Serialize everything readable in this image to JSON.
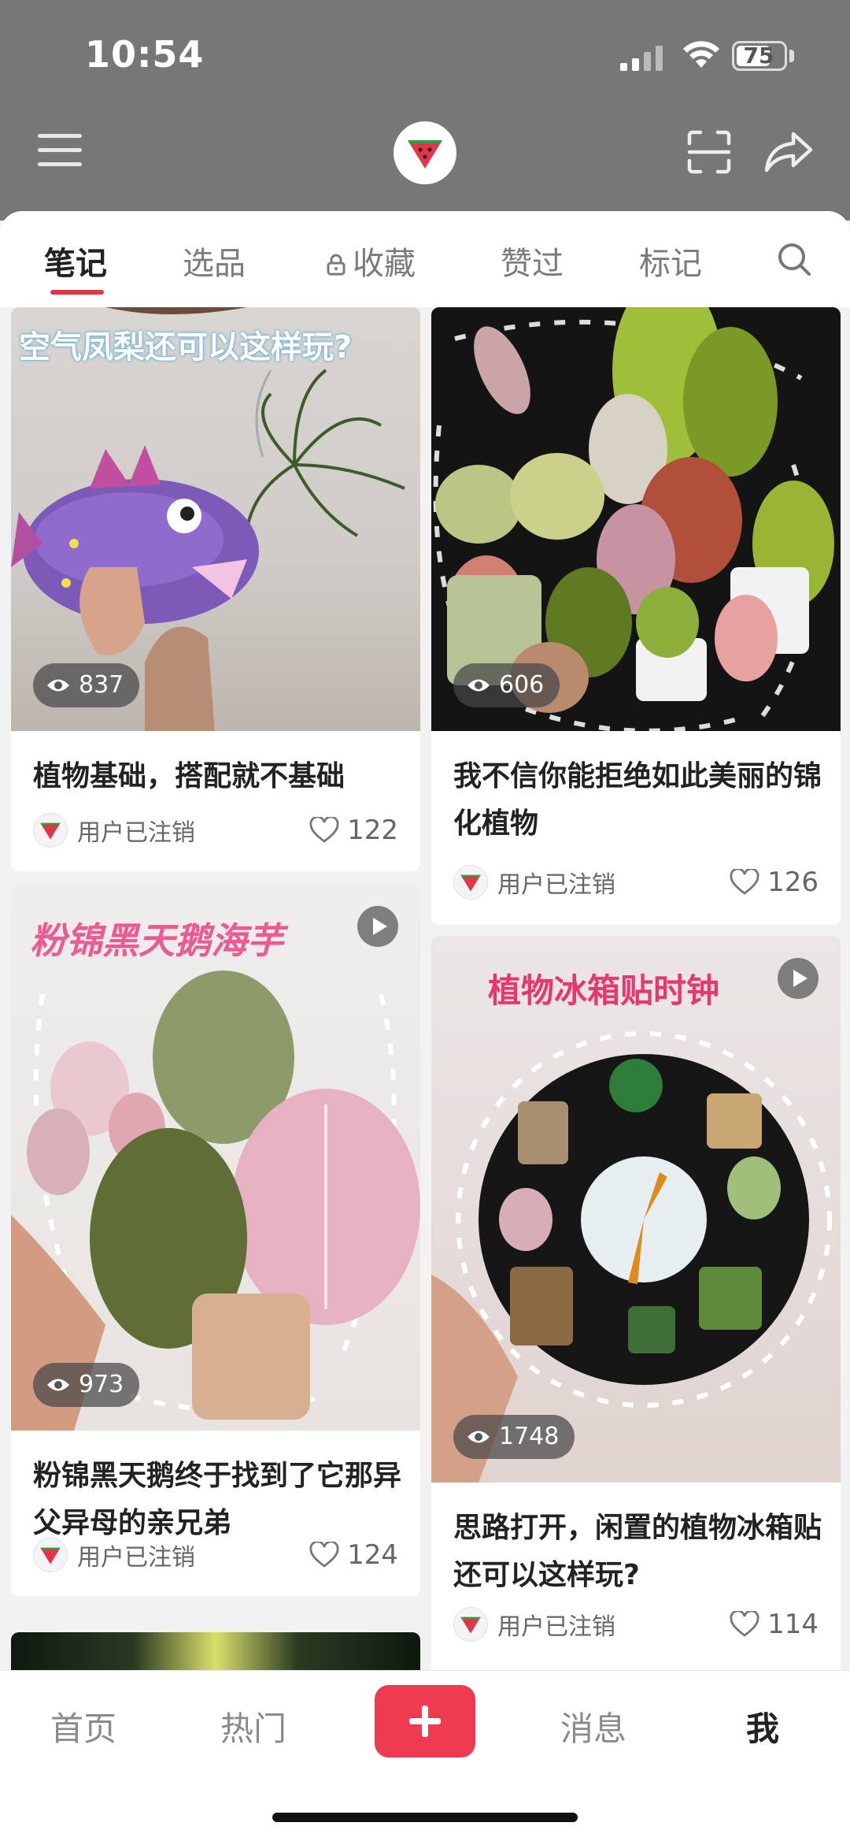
{
  "status_bar": {
    "time": "10:54",
    "battery": "75"
  },
  "tabs": [
    {
      "label": "笔记"
    },
    {
      "label": "选品"
    },
    {
      "label": "收藏"
    },
    {
      "label": "赞过"
    },
    {
      "label": "标记"
    }
  ],
  "posts": [
    {
      "overlay_text": "空气凤梨还可以这样玩?",
      "views": "837",
      "title": "植物基础，搭配就不基础",
      "author": "用户已注销",
      "likes": "122"
    },
    {
      "views": "606",
      "title": "我不信你能拒绝如此美丽的锦化植物",
      "author": "用户已注销",
      "likes": "126"
    },
    {
      "overlay_text": "粉锦黑天鹅海芋",
      "views": "973",
      "title": "粉锦黑天鹅终于找到了它那异父异母的亲兄弟",
      "author": "用户已注销",
      "likes": "124"
    },
    {
      "overlay_text": "植物冰箱贴时钟",
      "views": "1748",
      "title": "思路打开，闲置的植物冰箱贴还可以这样玩?",
      "author": "用户已注销",
      "likes": "114"
    }
  ],
  "bottom_nav": {
    "home": "首页",
    "hot": "热门",
    "messages": "消息",
    "me": "我"
  },
  "colors": {
    "accent": "#ee3a4f",
    "header_bg": "#777777"
  },
  "icons": [
    "menu-icon",
    "watermelon-logo-icon",
    "scan-icon",
    "share-icon",
    "lock-icon",
    "search-icon",
    "eye-icon",
    "play-icon",
    "heart-icon",
    "plus-icon"
  ]
}
